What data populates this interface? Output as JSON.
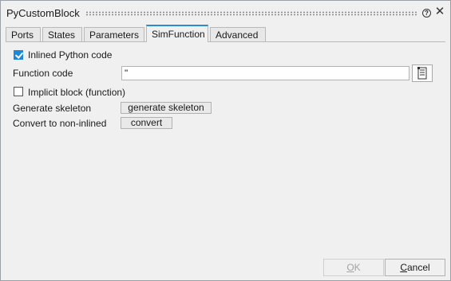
{
  "window": {
    "title": "PyCustomBlock",
    "help_glyph": "?",
    "close_glyph": "✕"
  },
  "tabs": [
    {
      "label": "Ports",
      "active": false
    },
    {
      "label": "States",
      "active": false
    },
    {
      "label": "Parameters",
      "active": false
    },
    {
      "label": "SimFunction",
      "active": true
    },
    {
      "label": "Advanced",
      "active": false
    }
  ],
  "simfunction": {
    "inlined_checkbox": {
      "label": "Inlined Python code",
      "checked": true
    },
    "function_code": {
      "label": "Function code",
      "value": "''"
    },
    "implicit_checkbox": {
      "label": "Implicit block (function)",
      "checked": false
    },
    "generate_skeleton": {
      "label": "Generate skeleton",
      "button": "generate skeleton"
    },
    "convert": {
      "label": "Convert to non-inlined",
      "button": "convert"
    }
  },
  "footer": {
    "ok_access_key": "O",
    "ok_rest": "K",
    "cancel_access_key": "C",
    "cancel_rest": "ancel"
  },
  "colors": {
    "accent": "#1e88d8",
    "active_tab_border": "#2b8ad6",
    "dialog_bg": "#f0f0f0"
  },
  "icons": {
    "help": "help-circle-icon",
    "close": "close-icon",
    "editor": "script-editor-icon"
  }
}
